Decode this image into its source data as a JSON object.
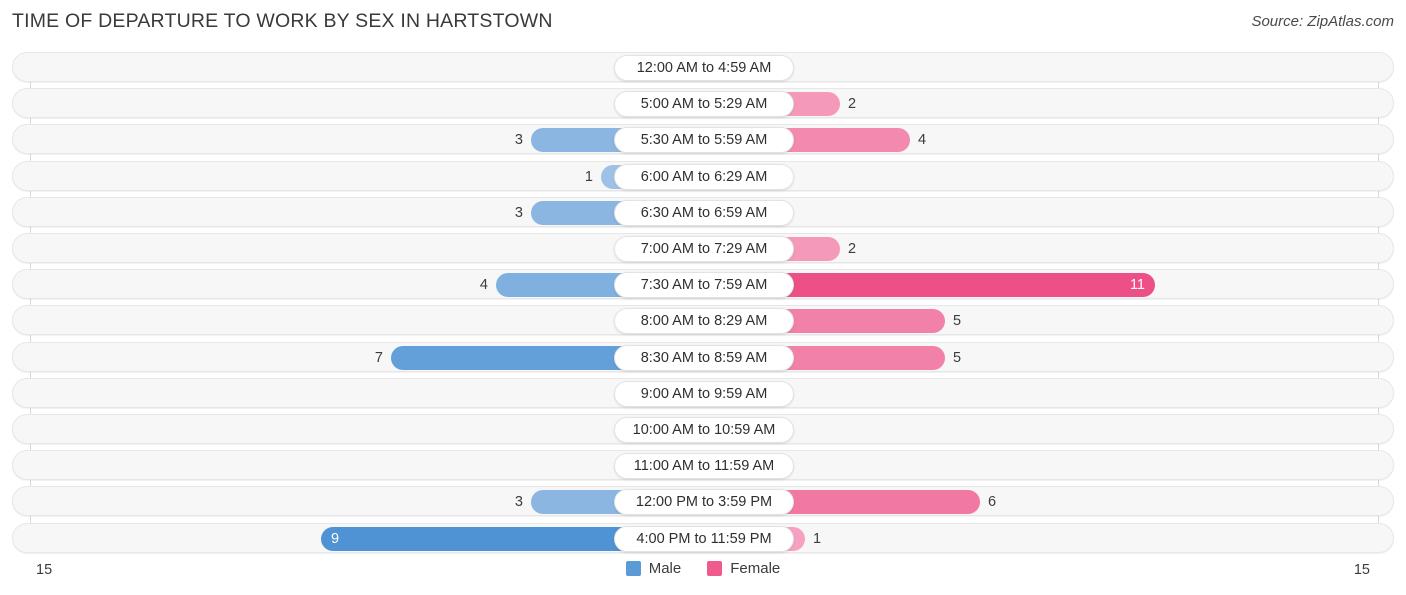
{
  "header": {
    "title": "TIME OF DEPARTURE TO WORK BY SEX IN HARTSTOWN",
    "source": "Source: ZipAtlas.com"
  },
  "legend": {
    "male_label": "Male",
    "female_label": "Female",
    "male_color": "#5b9bd5",
    "female_color": "#ef5b8c"
  },
  "axis": {
    "left_label": "15",
    "right_label": "15",
    "max": 15
  },
  "chart_data": {
    "type": "bar",
    "orientation": "horizontal-diverging",
    "title": "TIME OF DEPARTURE TO WORK BY SEX IN HARTSTOWN",
    "xlabel": "",
    "ylabel": "",
    "xlim": [
      15,
      15
    ],
    "grid": false,
    "legend_position": "bottom-center",
    "categories": [
      "12:00 AM to 4:59 AM",
      "5:00 AM to 5:29 AM",
      "5:30 AM to 5:59 AM",
      "6:00 AM to 6:29 AM",
      "6:30 AM to 6:59 AM",
      "7:00 AM to 7:29 AM",
      "7:30 AM to 7:59 AM",
      "8:00 AM to 8:29 AM",
      "8:30 AM to 8:59 AM",
      "9:00 AM to 9:59 AM",
      "10:00 AM to 10:59 AM",
      "11:00 AM to 11:59 AM",
      "12:00 PM to 3:59 PM",
      "4:00 PM to 11:59 PM"
    ],
    "series": [
      {
        "name": "Male",
        "values": [
          0,
          0,
          3,
          1,
          3,
          0,
          4,
          0,
          7,
          0,
          0,
          0,
          3,
          9
        ]
      },
      {
        "name": "Female",
        "values": [
          0,
          2,
          4,
          0,
          0,
          2,
          11,
          5,
          5,
          0,
          0,
          0,
          6,
          1
        ]
      }
    ]
  },
  "rows": [
    {
      "category": "12:00 AM to 4:59 AM",
      "male": "0",
      "female": "0"
    },
    {
      "category": "5:00 AM to 5:29 AM",
      "male": "0",
      "female": "2"
    },
    {
      "category": "5:30 AM to 5:59 AM",
      "male": "3",
      "female": "4"
    },
    {
      "category": "6:00 AM to 6:29 AM",
      "male": "1",
      "female": "0"
    },
    {
      "category": "6:30 AM to 6:59 AM",
      "male": "3",
      "female": "0"
    },
    {
      "category": "7:00 AM to 7:29 AM",
      "male": "0",
      "female": "2"
    },
    {
      "category": "7:30 AM to 7:59 AM",
      "male": "4",
      "female": "11"
    },
    {
      "category": "8:00 AM to 8:29 AM",
      "male": "0",
      "female": "5"
    },
    {
      "category": "8:30 AM to 8:59 AM",
      "male": "7",
      "female": "5"
    },
    {
      "category": "9:00 AM to 9:59 AM",
      "male": "0",
      "female": "0"
    },
    {
      "category": "10:00 AM to 10:59 AM",
      "male": "0",
      "female": "0"
    },
    {
      "category": "11:00 AM to 11:59 AM",
      "male": "0",
      "female": "0"
    },
    {
      "category": "12:00 PM to 3:59 PM",
      "male": "3",
      "female": "6"
    },
    {
      "category": "4:00 PM to 11:59 PM",
      "male": "9",
      "female": "1"
    }
  ]
}
